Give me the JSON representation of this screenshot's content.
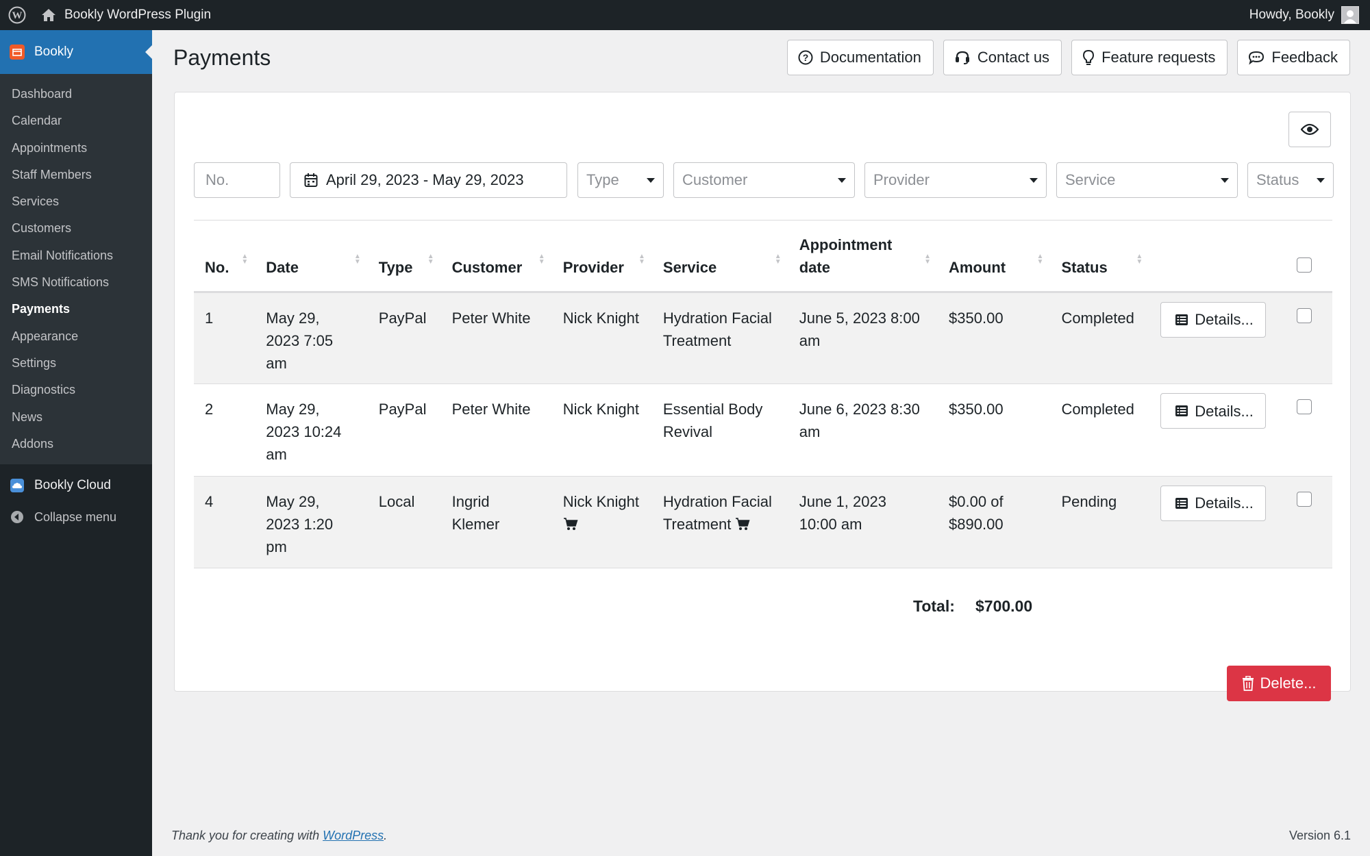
{
  "adminbar": {
    "site_name": "Bookly WordPress Plugin",
    "greeting": "Howdy, Bookly"
  },
  "sidebar": {
    "bookly_label": "Bookly",
    "items": [
      "Dashboard",
      "Calendar",
      "Appointments",
      "Staff Members",
      "Services",
      "Customers",
      "Email Notifications",
      "SMS Notifications",
      "Payments",
      "Appearance",
      "Settings",
      "Diagnostics",
      "News",
      "Addons"
    ],
    "active": "Payments",
    "cloud_label": "Bookly Cloud",
    "collapse_label": "Collapse menu"
  },
  "page": {
    "title": "Payments"
  },
  "top_buttons": {
    "documentation": "Documentation",
    "contact": "Contact us",
    "feature": "Feature requests",
    "feedback": "Feedback"
  },
  "filters": {
    "no_placeholder": "No.",
    "date_range": "April 29, 2023 - May 29, 2023",
    "type": "Type",
    "customer": "Customer",
    "provider": "Provider",
    "service": "Service",
    "status": "Status"
  },
  "table": {
    "headers": {
      "no": "No.",
      "date": "Date",
      "type": "Type",
      "customer": "Customer",
      "provider": "Provider",
      "service": "Service",
      "appointment_date": "Appointment date",
      "amount": "Amount",
      "status": "Status"
    },
    "details_label": "Details...",
    "rows": [
      {
        "no": "1",
        "date": "May 29, 2023 7:05 am",
        "type": "PayPal",
        "customer": "Peter White",
        "provider": "Nick Knight",
        "service": "Hydration Facial Treatment",
        "appointment_date": "June 5, 2023 8:00 am",
        "amount": "$350.00",
        "status": "Completed"
      },
      {
        "no": "2",
        "date": "May 29, 2023 10:24 am",
        "type": "PayPal",
        "customer": "Peter White",
        "provider": "Nick Knight",
        "service": "Essential Body Revival",
        "appointment_date": "June 6, 2023 8:30 am",
        "amount": "$350.00",
        "status": "Completed"
      },
      {
        "no": "4",
        "date": "May 29, 2023 1:20 pm",
        "type": "Local",
        "customer": "Ingrid Klemer",
        "provider": "Nick Knight",
        "service": "Hydration Facial Treatment",
        "appointment_date": "June 1, 2023 10:00 am",
        "amount": "$0.00 of $890.00",
        "status": "Pending"
      }
    ]
  },
  "total": {
    "label": "Total:",
    "value": "$700.00"
  },
  "delete_label": "Delete...",
  "footer": {
    "text": "Thank you for creating with ",
    "link": "WordPress",
    "suffix": ".",
    "version": "Version 6.1"
  },
  "colors": {
    "admin_dark": "#1d2327",
    "wp_blue": "#2271b1",
    "delete_red": "#dc3545"
  }
}
